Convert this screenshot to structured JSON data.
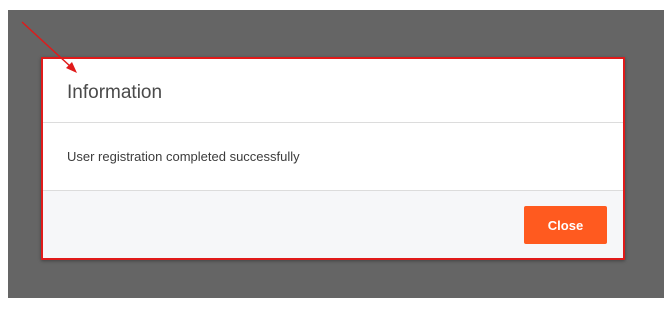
{
  "dialog": {
    "title": "Information",
    "message": "User registration completed successfully",
    "close_label": "Close"
  },
  "colors": {
    "overlay": "#656565",
    "highlight_border": "#e01a1a",
    "annotation_arrow": "#e01a1a",
    "close_button": "#ff5a1f",
    "footer_background": "#f6f7f9"
  },
  "icons": {
    "annotation": "arrow-pointer-icon"
  }
}
